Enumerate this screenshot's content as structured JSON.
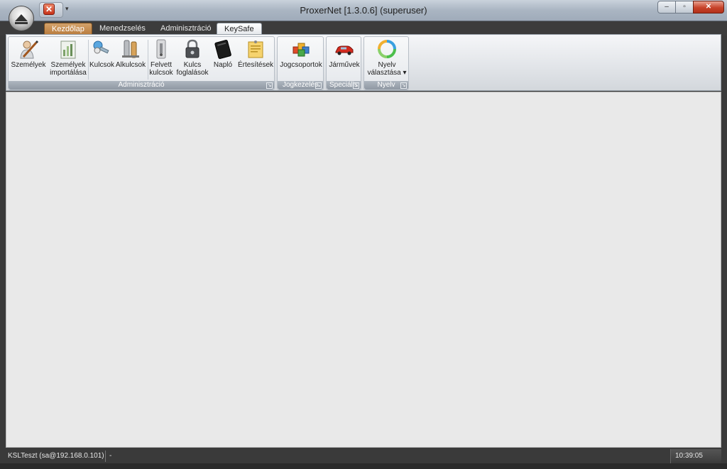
{
  "window": {
    "title": "ProxerNet [1.3.0.6] (superuser)",
    "min_symbol": "‒",
    "max_symbol": "▫",
    "close_symbol": "✕"
  },
  "qat": {
    "close_symbol": "✕",
    "dropdown_symbol": "▾"
  },
  "tabs": [
    {
      "label": "Kezdőlap"
    },
    {
      "label": "Menedzselés"
    },
    {
      "label": "Adminisztráció"
    },
    {
      "label": "KeySafe"
    }
  ],
  "ribbon": {
    "groups": [
      {
        "label": "Adminisztráció"
      },
      {
        "label": "Jogkezelés"
      },
      {
        "label": "Speciális"
      },
      {
        "label": "Nyelv"
      }
    ],
    "buttons": [
      {
        "label": "Személyek",
        "icon": "person-pen-icon"
      },
      {
        "label": "Személyek importálása",
        "icon": "import-chart-icon"
      },
      {
        "label": "Kulcsok",
        "icon": "keys-icon"
      },
      {
        "label": "Alkulcsok",
        "icon": "subkeys-icon"
      },
      {
        "label": "Felvett kulcsok",
        "icon": "key-taken-icon"
      },
      {
        "label": "Kulcs foglalások",
        "icon": "key-lock-icon"
      },
      {
        "label": "Napló",
        "icon": "log-book-icon"
      },
      {
        "label": "Értesítések",
        "icon": "notes-icon"
      },
      {
        "label": "Jogcsoportok",
        "icon": "cubes-icon"
      },
      {
        "label": "Járművek",
        "icon": "car-icon"
      },
      {
        "label": "Nyelv választása",
        "icon": "language-cycle-icon"
      }
    ],
    "launcher_symbol": "↘",
    "dropdown_symbol": "▾"
  },
  "status": {
    "connection": "KSLTeszt (sa@192.168.0.101)",
    "extra": "-",
    "clock": "10:39:05"
  },
  "colors": {
    "home_tab": "#c48a4c",
    "content_bg": "#e9e9e9",
    "status_bg": "#3a3a3a"
  }
}
